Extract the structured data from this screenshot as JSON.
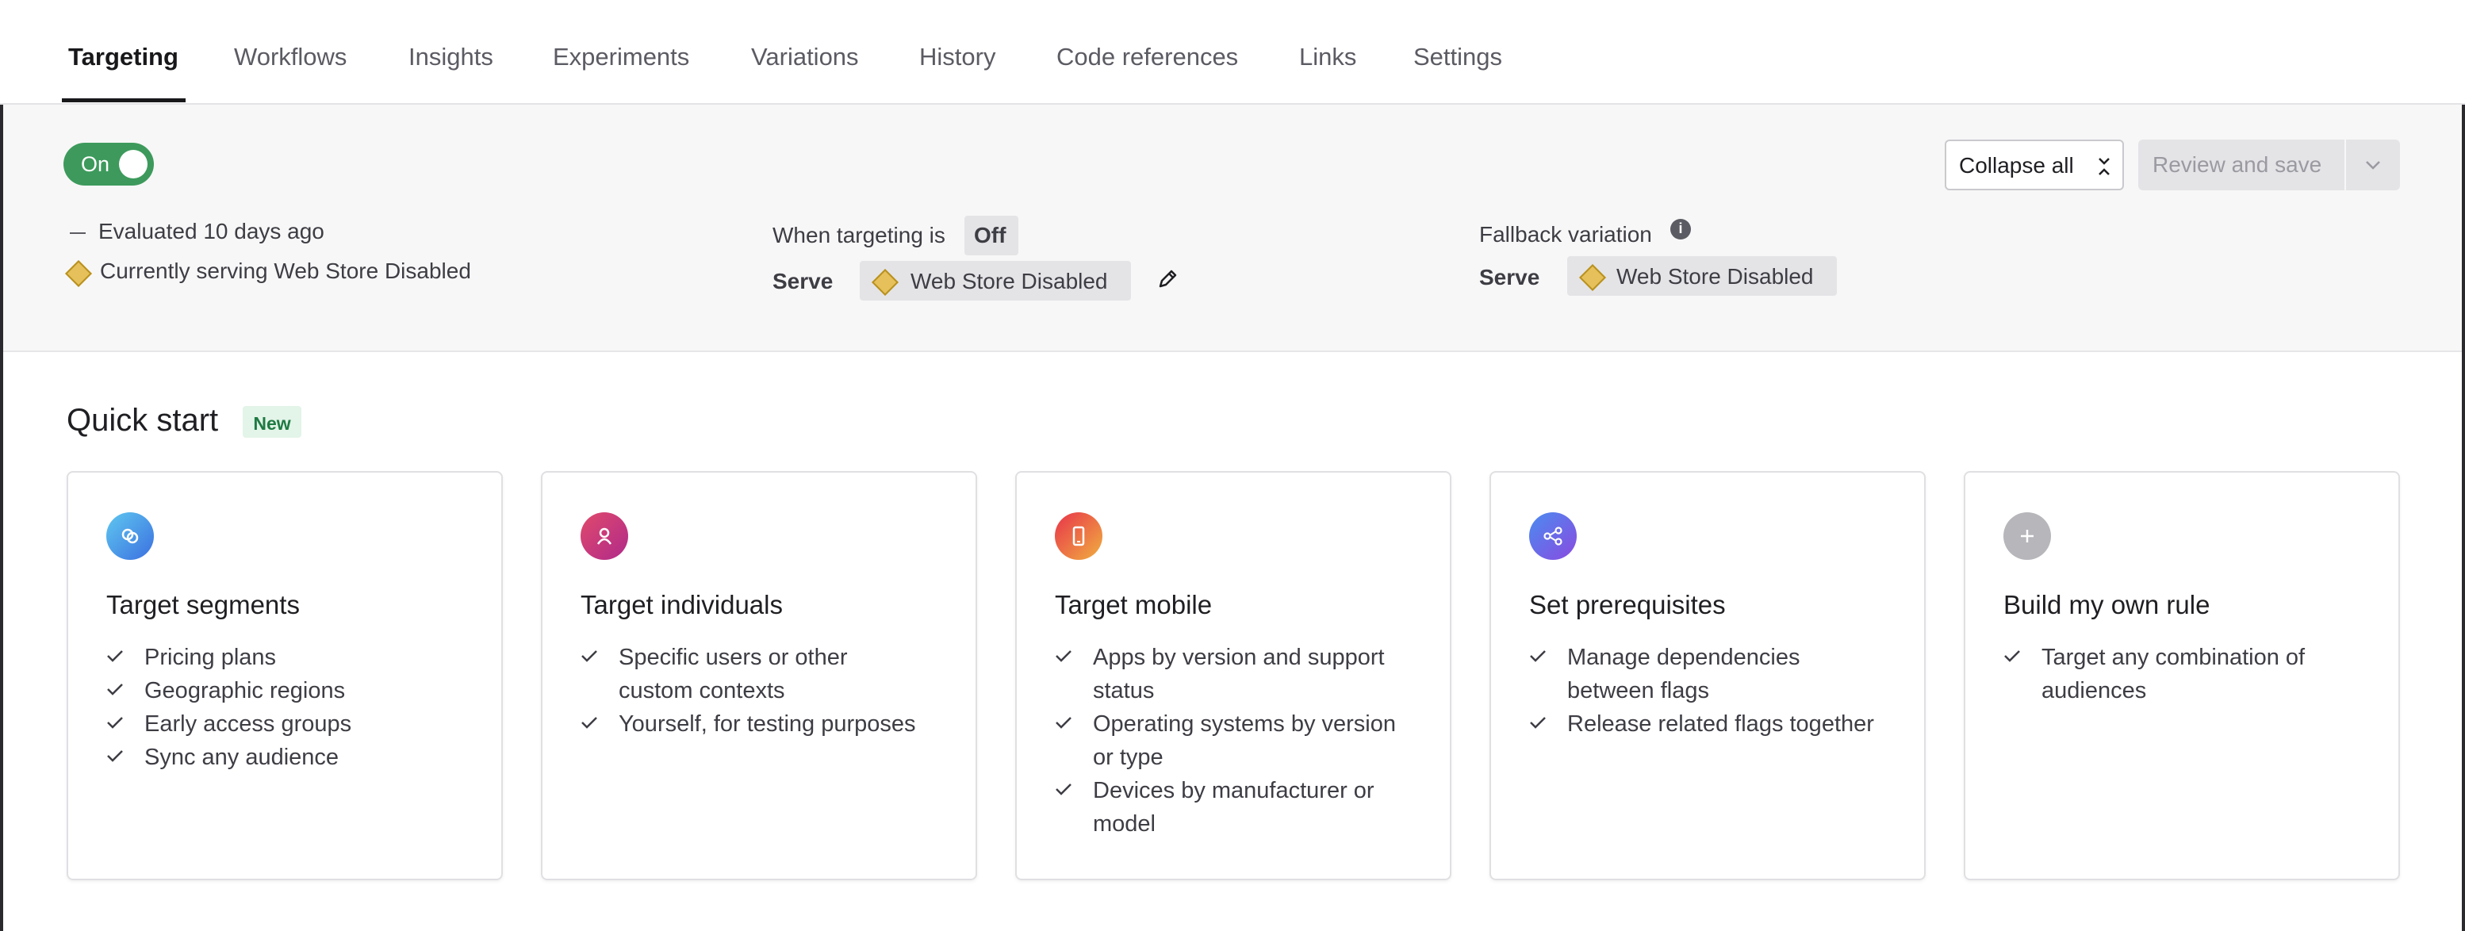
{
  "tabs": [
    {
      "label": "Targeting",
      "active": true
    },
    {
      "label": "Workflows"
    },
    {
      "label": "Insights"
    },
    {
      "label": "Experiments"
    },
    {
      "label": "Variations"
    },
    {
      "label": "History"
    },
    {
      "label": "Code references"
    },
    {
      "label": "Links"
    },
    {
      "label": "Settings"
    }
  ],
  "targeting": {
    "toggle_label": "On",
    "toggle_state": "on",
    "evaluated": "Evaluated 10 days ago",
    "serving": "Currently serving Web Store Disabled",
    "when_targeting_label": "When targeting is",
    "when_targeting_value": "Off",
    "serve_label": "Serve",
    "serve_value": "Web Store Disabled",
    "fallback_label": "Fallback variation",
    "fallback_serve_label": "Serve",
    "fallback_value": "Web Store Disabled",
    "collapse_all": "Collapse all",
    "review_and_save": "Review and save"
  },
  "quick_start": {
    "title": "Quick start",
    "badge": "New",
    "cards": [
      {
        "icon": "segments-icon",
        "color": "#4a9fe8",
        "title": "Target segments",
        "bullets": [
          "Pricing plans",
          "Geographic regions",
          "Early access groups",
          "Sync any audience"
        ]
      },
      {
        "icon": "user-icon",
        "color": "#d6337a",
        "title": "Target individuals",
        "bullets": [
          [
            "Specific users or other",
            "custom contexts"
          ],
          "Yourself, for testing purposes"
        ]
      },
      {
        "icon": "mobile-icon",
        "color": "#e8663c",
        "title": "Target mobile",
        "bullets": [
          [
            "Apps by version and support",
            "status"
          ],
          [
            "Operating systems by version",
            "or type"
          ],
          [
            "Devices by manufacturer or",
            "model"
          ]
        ]
      },
      {
        "icon": "share-nodes-icon",
        "color": "#6a63e0",
        "title": "Set prerequisites",
        "bullets": [
          [
            "Manage dependencies",
            "between flags"
          ],
          "Release related flags together"
        ]
      },
      {
        "icon": "plus-icon",
        "color": "#b6b6bb",
        "title": "Build my own rule",
        "bullets": [
          [
            "Target any combination of",
            "audiences"
          ]
        ]
      }
    ]
  }
}
